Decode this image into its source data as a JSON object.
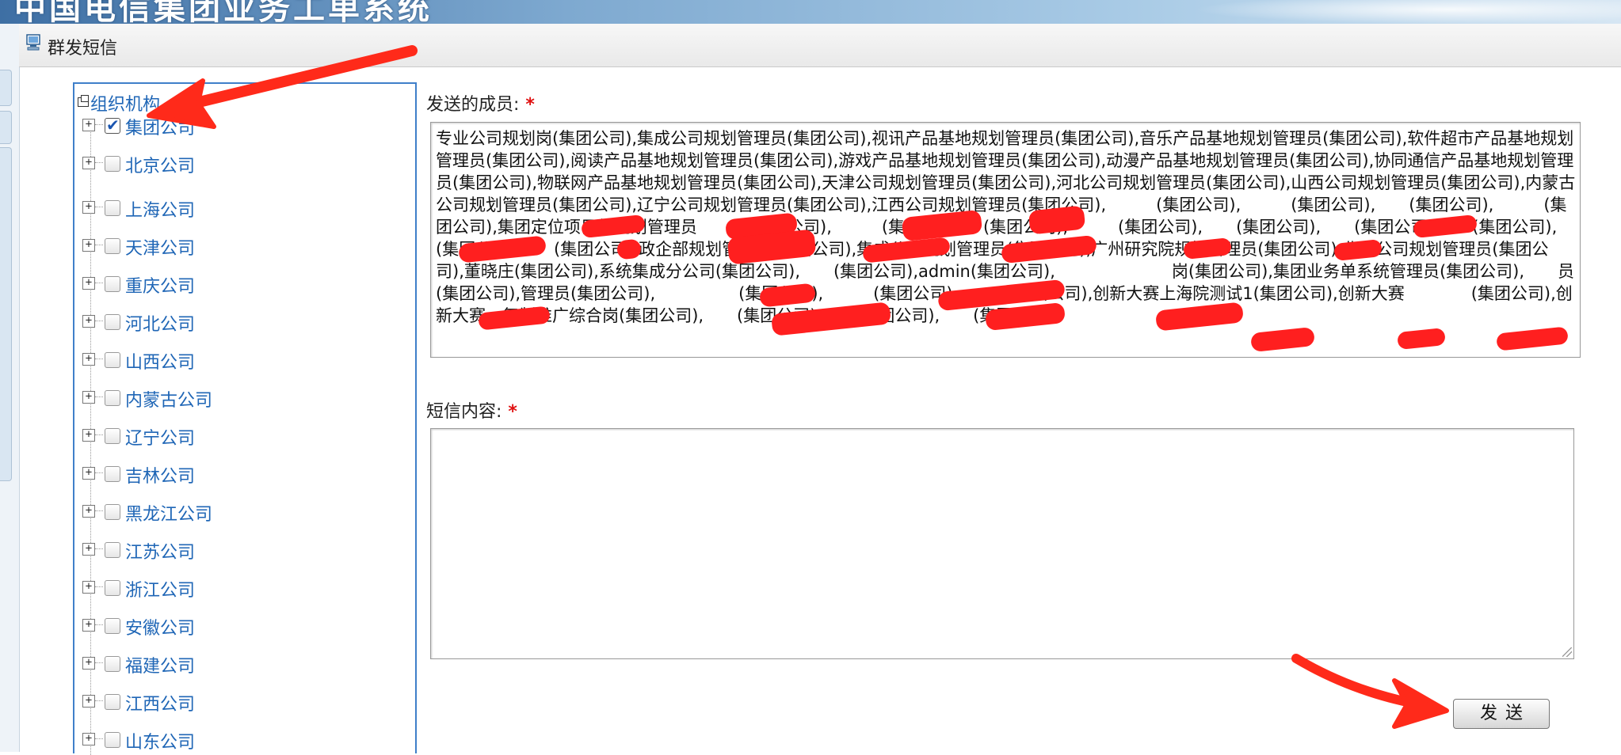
{
  "banner": {
    "title": "中国电信集团业务工单系统"
  },
  "panel": {
    "title": "群发短信"
  },
  "tree": {
    "root_label": "组织机构",
    "nodes": [
      {
        "label": "集团公司",
        "checked": true
      },
      {
        "label": "北京公司",
        "checked": false
      },
      {
        "label": "上海公司",
        "checked": false
      },
      {
        "label": "天津公司",
        "checked": false
      },
      {
        "label": "重庆公司",
        "checked": false
      },
      {
        "label": "河北公司",
        "checked": false
      },
      {
        "label": "山西公司",
        "checked": false
      },
      {
        "label": "内蒙古公司",
        "checked": false
      },
      {
        "label": "辽宁公司",
        "checked": false
      },
      {
        "label": "吉林公司",
        "checked": false
      },
      {
        "label": "黑龙江公司",
        "checked": false
      },
      {
        "label": "江苏公司",
        "checked": false
      },
      {
        "label": "浙江公司",
        "checked": false
      },
      {
        "label": "安徽公司",
        "checked": false
      },
      {
        "label": "福建公司",
        "checked": false
      },
      {
        "label": "江西公司",
        "checked": false
      },
      {
        "label": "山东公司",
        "checked": false
      }
    ]
  },
  "form": {
    "members_label": "发送的成员:",
    "members_value": "专业公司规划岗(集团公司),集成公司规划管理员(集团公司),视讯产品基地规划管理员(集团公司),音乐产品基地规划管理员(集团公司),软件超市产品基地规划管理员(集团公司),阅读产品基地规划管理员(集团公司),游戏产品基地规划管理员(集团公司),动漫产品基地规划管理员(集团公司),协同通信产品基地规划管理员(集团公司),物联网产品基地规划管理员(集团公司),天津公司规划管理员(集团公司),河北公司规划管理员(集团公司),山西公司规划管理员(集团公司),内蒙古公司规划管理员(集团公司),辽宁公司规划管理员(集团公司),江西公司规划管理员(集团公司),　　　(集团公司),　　　(集团公司),　　(集团公司),　　　(集团公司),集团定位项目组规划管理员　　　(集团公司),　　　(集团公司),　(集团公司),　　　(集团公司),　　(集团公司),　　(集团公司),　　(集团公司),　　(集团公司),　　(集团公司),政企部规划管理员(集团公司),集成公司规划管理员(集团公司),广州研究院规划管理员(集团公司),北京公司规划管理员(集团公司),董晓庄(集团公司),系统集成分公司(集团公司),　　(集团公司),admin(集团公司),　　　　　　　岗(集团公司),集团业务单系统管理员(集团公司),　　员(集团公司),管理员(集团公司),　　　　　(集团公司),　　　(集团公司),　　　(集团公司),创新大赛上海院测试1(集团公司),创新大赛　　　　(集团公司),创新大赛、复制推广综合岗(集团公司),　　(集团公司),　　(集团公司),　　(集团公司),",
    "content_label": "短信内容:",
    "content_value": "",
    "required_mark": "*",
    "send_label": "发送"
  },
  "colors": {
    "tree_border": "#3f7fc9",
    "link": "#1f66b6",
    "required": "#e01010",
    "annotation_arrow": "#ff2a1a"
  }
}
